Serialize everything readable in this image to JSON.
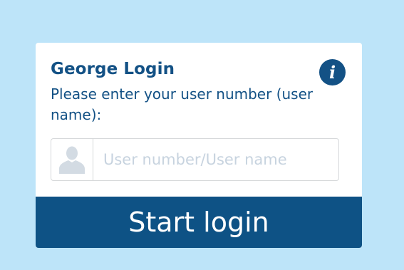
{
  "login": {
    "title": "George Login",
    "subtitle": "Please enter your user number (user name):",
    "info_icon": "info-icon",
    "user_icon": "user-silhouette-icon",
    "input": {
      "placeholder": "User number/User name",
      "value": ""
    },
    "start_button_label": "Start login"
  },
  "colors": {
    "background": "#bde4f9",
    "brand": "#135185",
    "button": "#0e5285",
    "placeholder": "#c7d3df"
  }
}
